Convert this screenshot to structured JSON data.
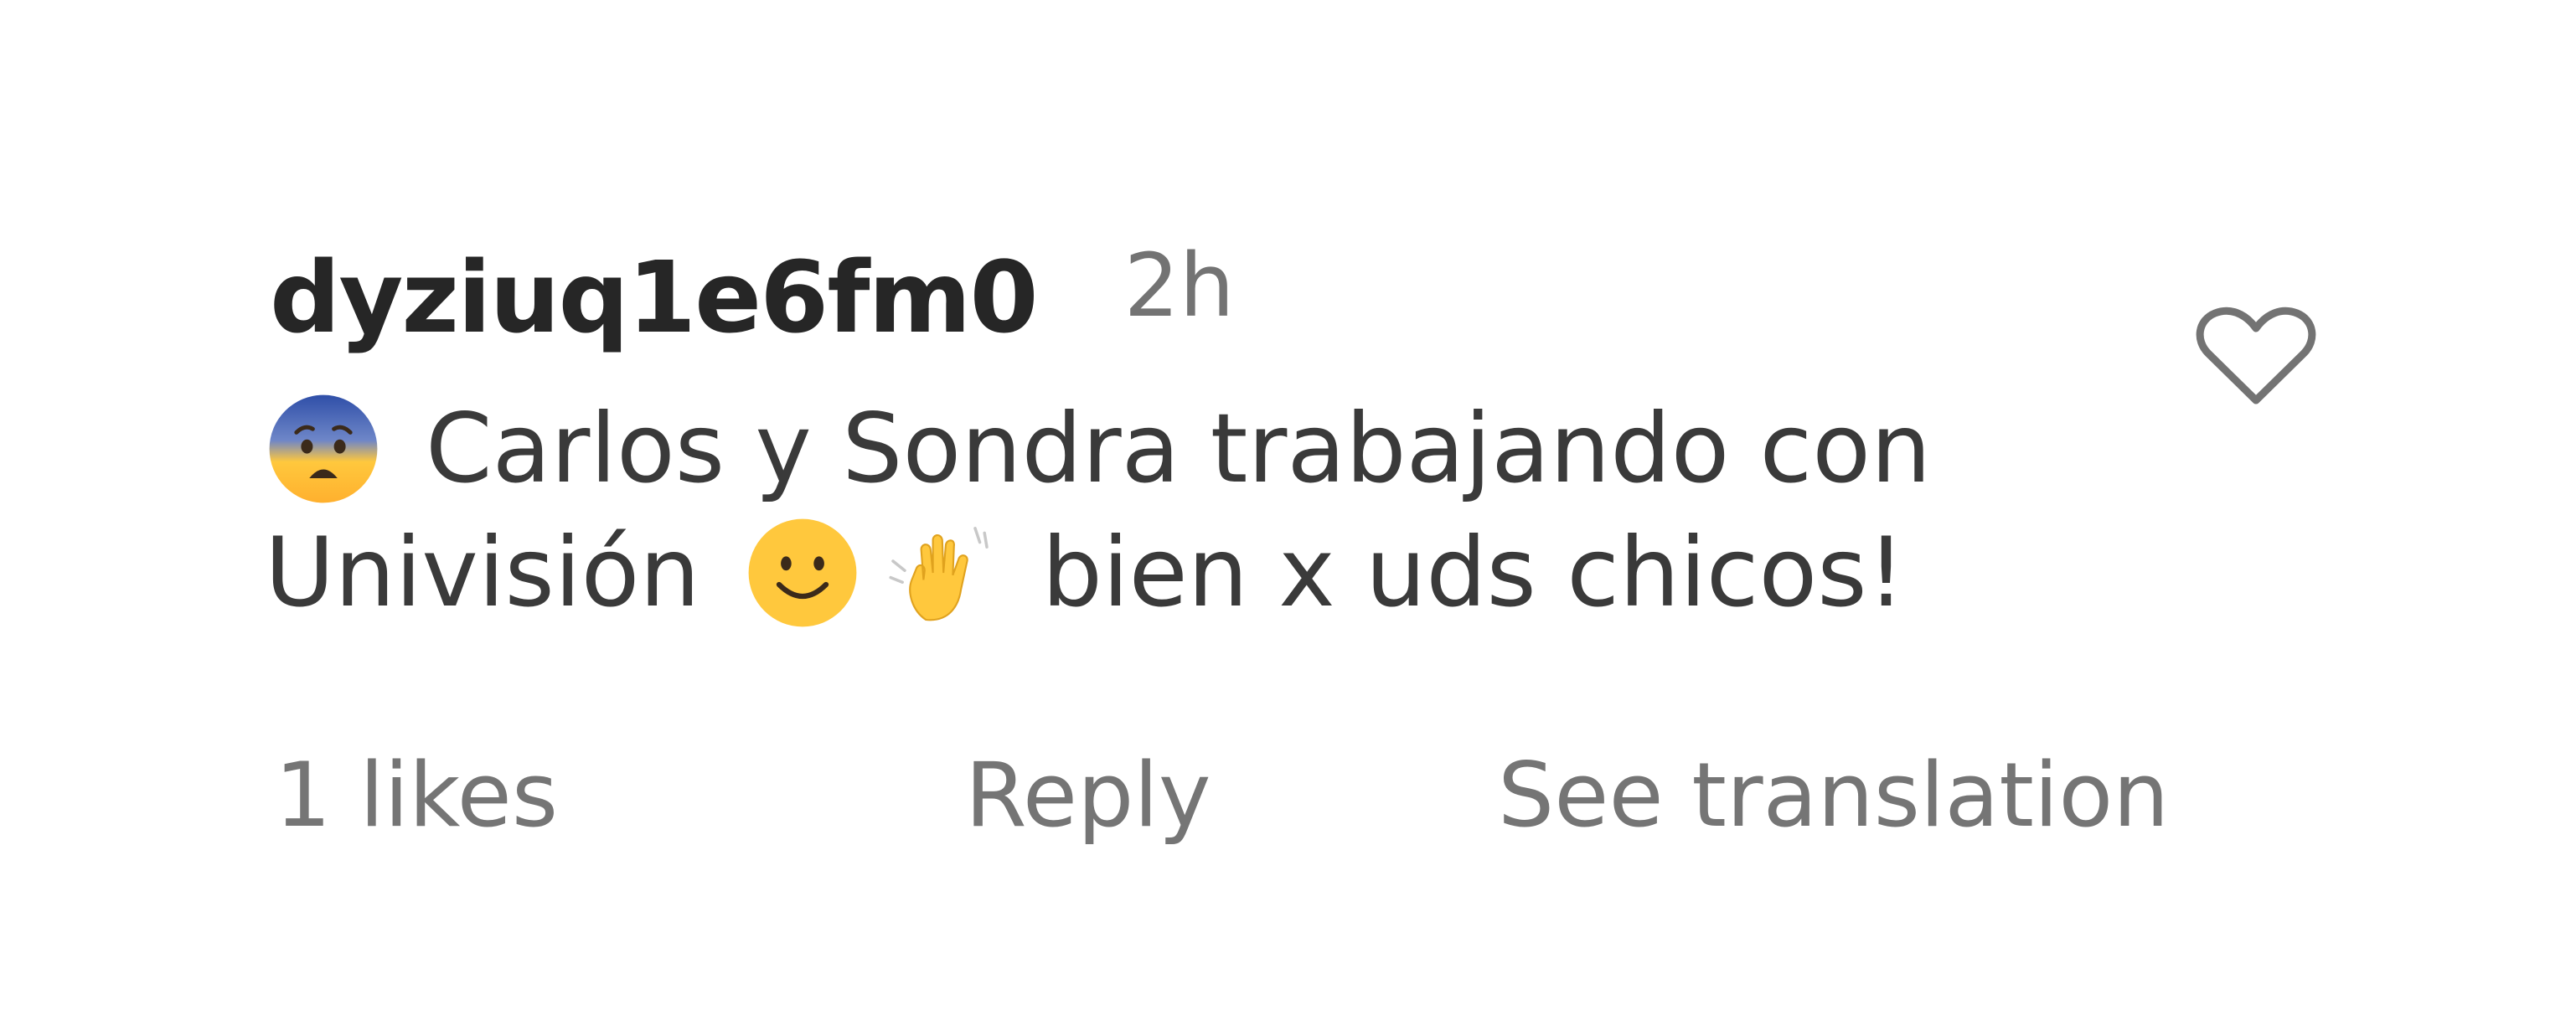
{
  "comment": {
    "username": "dyziuq1e6fm0",
    "time_ago": "2h",
    "text_line1": "Carlos y Sondra trabajando con",
    "text_line2_a": "Univisión",
    "text_line2_b": "bien x uds chicos!",
    "emojis": {
      "first": "anxious-face-icon",
      "second": "smiling-face-icon",
      "third": "waving-hand-icon"
    },
    "like_icon": "heart-outline-icon"
  },
  "actions": {
    "likes": "1 likes",
    "reply": "Reply",
    "translate": "See translation"
  },
  "colors": {
    "username": "#262626",
    "text": "#3a3a3a",
    "muted": "#757575",
    "emoji_yellow": "#ffc83d",
    "emoji_blue": "#2f4fa8"
  }
}
